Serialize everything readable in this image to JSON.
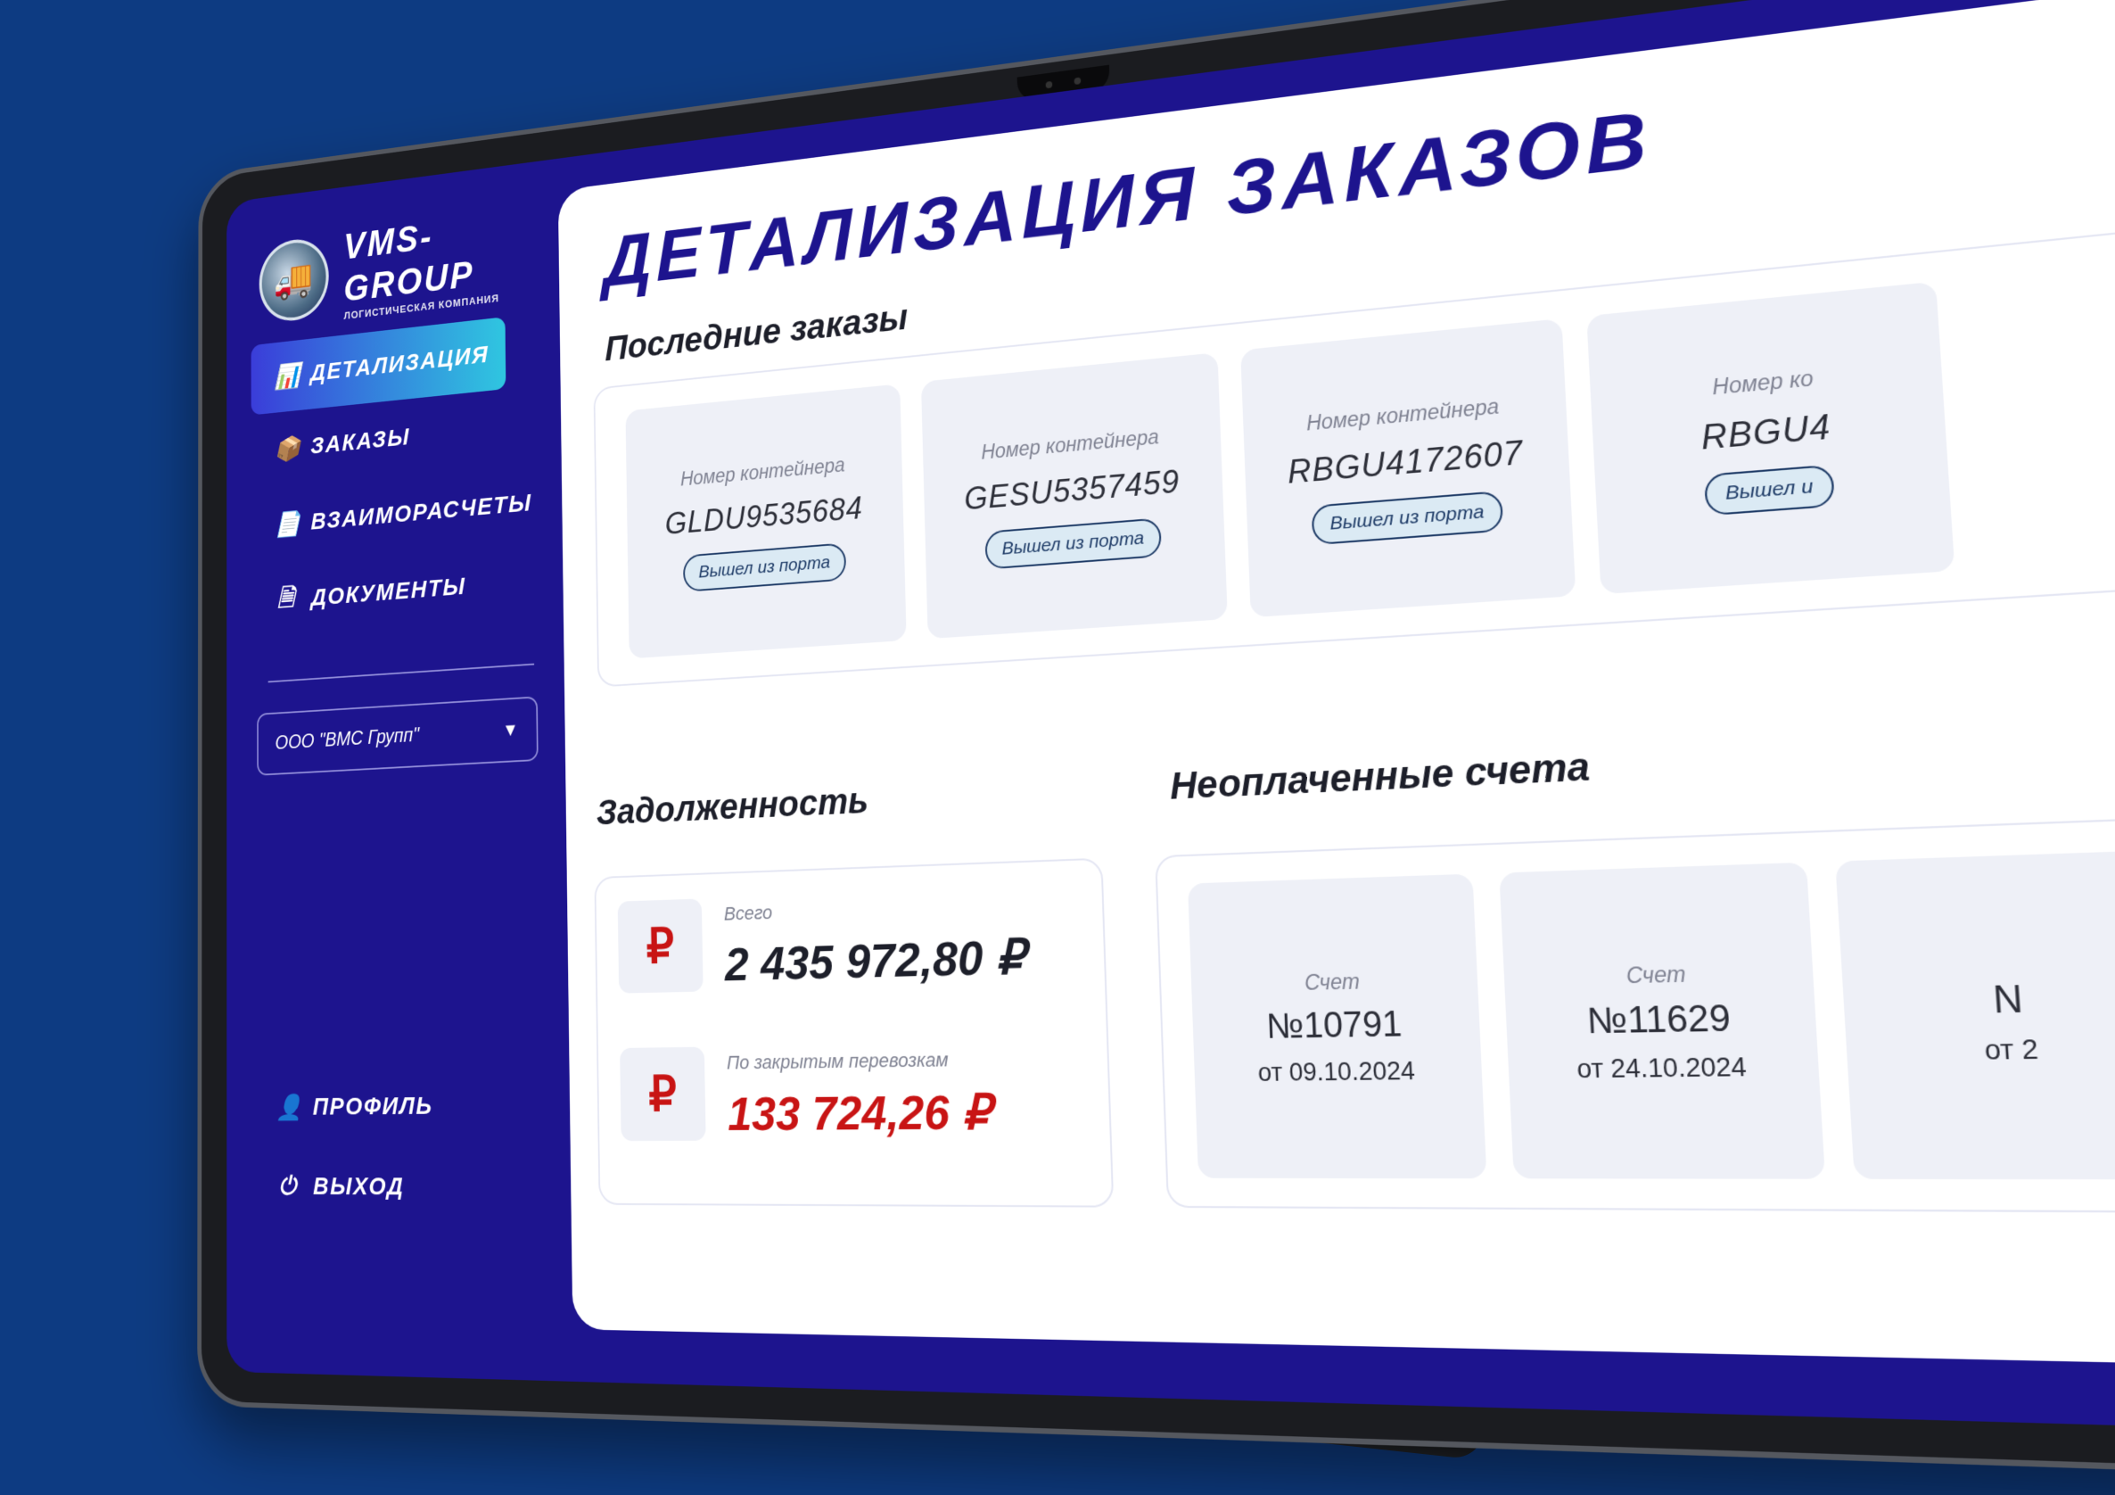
{
  "brand": {
    "title": "VMS-GROUP",
    "subtitle": "ЛОГИСТИЧЕСКАЯ КОМПАНИЯ",
    "logo_icon": "truck-logo-icon"
  },
  "sidebar": {
    "items": [
      {
        "label": "ДЕТАЛИЗАЦИЯ",
        "icon": "bar-chart-icon",
        "active": true
      },
      {
        "label": "ЗАКАЗЫ",
        "icon": "box-icon",
        "active": false
      },
      {
        "label": "ВЗАИМОРАСЧЕТЫ",
        "icon": "file-icon",
        "active": false
      },
      {
        "label": "ДОКУМЕНТЫ",
        "icon": "document-icon",
        "active": false
      }
    ],
    "company_select": {
      "value": "ООО \"ВМС Групп\""
    },
    "bottom": [
      {
        "label": "ПРОФИЛЬ",
        "icon": "user-icon"
      },
      {
        "label": "ВЫХОД",
        "icon": "exit-icon"
      }
    ]
  },
  "main": {
    "title": "ДЕТАЛИЗАЦИЯ ЗАКАЗОВ",
    "recent_orders": {
      "title": "Последние заказы",
      "cards": [
        {
          "label": "Номер контейнера",
          "number": "GLDU9535684",
          "status": "Вышел из порта"
        },
        {
          "label": "Номер контейнера",
          "number": "GESU5357459",
          "status": "Вышел из порта"
        },
        {
          "label": "Номер контейнера",
          "number": "RBGU4172607",
          "status": "Вышел из порта"
        },
        {
          "label": "Номер ко",
          "number": "RBGU4",
          "status": "Вышел и"
        }
      ]
    },
    "debt": {
      "title": "Задолженность",
      "total_label": "Всего",
      "total_value": "2 435 972,80 ₽",
      "closed_label": "По закрытым перевозкам",
      "closed_value": "133 724,26 ₽",
      "currency_symbol": "₽"
    },
    "invoices": {
      "title": "Неоплаченные счета",
      "cards": [
        {
          "label": "Счет",
          "number": "№10791",
          "date": "от 09.10.2024"
        },
        {
          "label": "Счет",
          "number": "№11629",
          "date": "от 24.10.2024"
        },
        {
          "label": "",
          "number": "N",
          "date": "от 2"
        }
      ]
    }
  },
  "colors": {
    "background": "#0d3b82",
    "sidebar": "#1d148e",
    "accent_start": "#3a3dd9",
    "accent_end": "#2fc6e0",
    "debt_red": "#c81414"
  }
}
